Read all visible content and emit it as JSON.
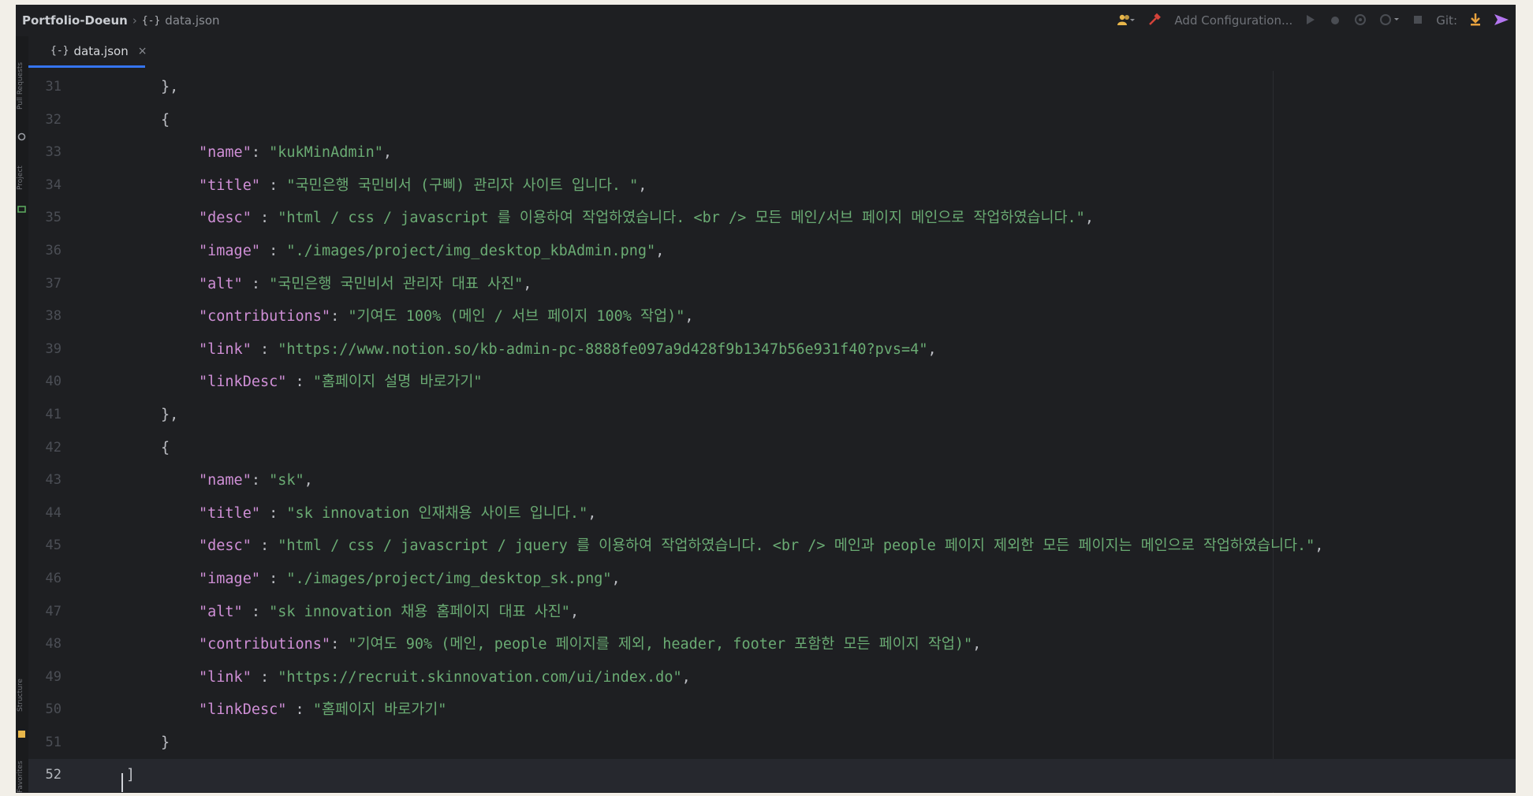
{
  "titlebar": {
    "project": "Portfolio-Doeun",
    "separator": "›",
    "file_glyph": "{-}",
    "file": "data.json",
    "add_configuration": "Add Configuration...",
    "git_label": "Git:"
  },
  "tab": {
    "glyph": "{-}",
    "label": "data.json",
    "close": "×"
  },
  "left_strip": {
    "pull_requests": "Pull Requests",
    "project": "Project",
    "structure": "Structure",
    "favorites": "Favorites"
  },
  "icons": {
    "user": "user-icon",
    "hammer": "hammer-icon",
    "run": "run-icon",
    "debug": "debug-icon",
    "coverage": "coverage-icon",
    "profile": "profile-icon",
    "stop": "stop-icon",
    "git_update": "git-update-icon",
    "git_push": "git-push-icon"
  },
  "colors": {
    "background": "#1e1f22",
    "key": "#cf8fd6",
    "string": "#6aab73",
    "punctuation": "#bcbec4",
    "line_number": "#4b4e55",
    "accent": "#3574f0"
  },
  "editor": {
    "current_line": 52,
    "lines": [
      {
        "n": "31",
        "indent": 0,
        "text": "},"
      },
      {
        "n": "32",
        "indent": 0,
        "text": "{"
      },
      {
        "n": "33",
        "indent": 1,
        "key": "\"name\"",
        "sep": ": ",
        "value": "\"kukMinAdmin\"",
        "end": ","
      },
      {
        "n": "34",
        "indent": 1,
        "key": "\"title\"",
        "sep": " : ",
        "value": "\"국민은행 국민비서 (구삐) 관리자 사이트 입니다. \"",
        "end": ","
      },
      {
        "n": "35",
        "indent": 1,
        "key": "\"desc\"",
        "sep": " : ",
        "value": "\"html / css / javascript 를 이용하여 작업하였습니다. <br /> 모든 메인/서브 페이지 메인으로 작업하였습니다.\"",
        "end": ","
      },
      {
        "n": "36",
        "indent": 1,
        "key": "\"image\"",
        "sep": " : ",
        "value": "\"./images/project/img_desktop_kbAdmin.png\"",
        "end": ","
      },
      {
        "n": "37",
        "indent": 1,
        "key": "\"alt\"",
        "sep": " : ",
        "value": "\"국민은행 국민비서 관리자 대표 사진\"",
        "end": ","
      },
      {
        "n": "38",
        "indent": 1,
        "key": "\"contributions\"",
        "sep": ": ",
        "value": "\"기여도 100% (메인 / 서브 페이지 100% 작업)\"",
        "end": ","
      },
      {
        "n": "39",
        "indent": 1,
        "key": "\"link\"",
        "sep": " : ",
        "value": "\"https://www.notion.so/kb-admin-pc-8888fe097a9d428f9b1347b56e931f40?pvs=4\"",
        "end": ","
      },
      {
        "n": "40",
        "indent": 1,
        "key": "\"linkDesc\"",
        "sep": " : ",
        "value": "\"홈페이지 설명 바로가기\"",
        "end": ""
      },
      {
        "n": "41",
        "indent": 0,
        "text": "},"
      },
      {
        "n": "42",
        "indent": 0,
        "text": "{"
      },
      {
        "n": "43",
        "indent": 1,
        "key": "\"name\"",
        "sep": ": ",
        "value": "\"sk\"",
        "end": ","
      },
      {
        "n": "44",
        "indent": 1,
        "key": "\"title\"",
        "sep": " : ",
        "value": "\"sk innovation 인재채용 사이트 입니다.\"",
        "end": ","
      },
      {
        "n": "45",
        "indent": 1,
        "key": "\"desc\"",
        "sep": " : ",
        "value": "\"html / css / javascript / jquery 를 이용하여 작업하였습니다. <br /> 메인과 people 페이지 제외한 모든 페이지는 메인으로 작업하였습니다.\"",
        "end": ","
      },
      {
        "n": "46",
        "indent": 1,
        "key": "\"image\"",
        "sep": " : ",
        "value": "\"./images/project/img_desktop_sk.png\"",
        "end": ","
      },
      {
        "n": "47",
        "indent": 1,
        "key": "\"alt\"",
        "sep": " : ",
        "value": "\"sk innovation 채용 홈페이지 대표 사진\"",
        "end": ","
      },
      {
        "n": "48",
        "indent": 1,
        "key": "\"contributions\"",
        "sep": ": ",
        "value": "\"기여도 90% (메인, people 페이지를 제외, header, footer 포함한 모든 페이지 작업)\"",
        "end": ","
      },
      {
        "n": "49",
        "indent": 1,
        "key": "\"link\"",
        "sep": " : ",
        "value": "\"https://recruit.skinnovation.com/ui/index.do\"",
        "end": ","
      },
      {
        "n": "50",
        "indent": 1,
        "key": "\"linkDesc\"",
        "sep": " : ",
        "value": "\"홈페이지 바로가기\"",
        "end": ""
      },
      {
        "n": "51",
        "indent": 0,
        "text": "}"
      },
      {
        "n": "52",
        "indent": -1,
        "text": "]"
      }
    ]
  }
}
